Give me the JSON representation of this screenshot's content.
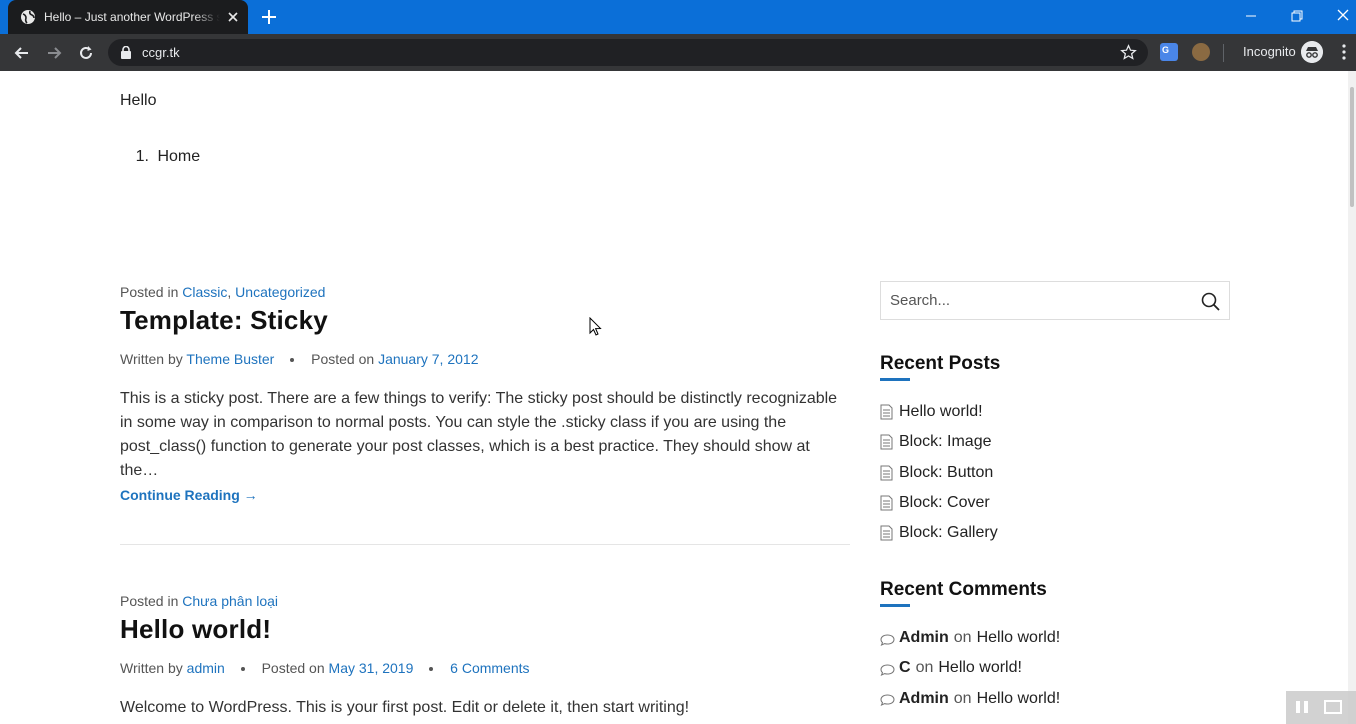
{
  "browser": {
    "tab_title": "Hello – Just another WordPress site",
    "url": "ccgr.tk",
    "incognito_label": "Incognito"
  },
  "site": {
    "title": "Hello",
    "menu": [
      {
        "number": "1.",
        "label": "Home"
      }
    ]
  },
  "posts": [
    {
      "posted_in_label": "Posted in",
      "categories": [
        "Classic",
        "Uncategorized"
      ],
      "category_sep": ",",
      "title": "Template: Sticky",
      "written_by_label": "Written by",
      "author": "Theme Buster",
      "posted_on_label": "Posted on",
      "date": "January 7, 2012",
      "excerpt": "This is a sticky post. There are a few things to verify: The sticky post should be distinctly recognizable in some way in comparison to normal posts. You can style the .sticky class if you are using the post_class() function to generate your post classes, which is a best practice. They should show at the…",
      "continue_label": "Continue Reading →"
    },
    {
      "posted_in_label": "Posted in",
      "categories": [
        "Chưa phân loại"
      ],
      "title": "Hello world!",
      "written_by_label": "Written by",
      "author": "admin",
      "posted_on_label": "Posted on",
      "date": "May 31, 2019",
      "comments": "6 Comments",
      "excerpt": "Welcome to WordPress. This is your first post. Edit or delete it, then start writing!"
    }
  ],
  "sidebar": {
    "search_placeholder": "Search...",
    "recent_posts_title": "Recent Posts",
    "recent_posts": [
      "Hello world!",
      "Block: Image",
      "Block: Button",
      "Block: Cover",
      "Block: Gallery"
    ],
    "recent_comments_title": "Recent Comments",
    "recent_comments": [
      {
        "author": "Admin",
        "on": "on",
        "post": "Hello world!"
      },
      {
        "author": "C",
        "on": "on",
        "post": "Hello world!"
      },
      {
        "author": "Admin",
        "on": "on",
        "post": "Hello world!"
      }
    ]
  },
  "colors": {
    "accent": "#1e73be",
    "tabbar": "#0b6fd8",
    "toolbar": "#353638"
  }
}
